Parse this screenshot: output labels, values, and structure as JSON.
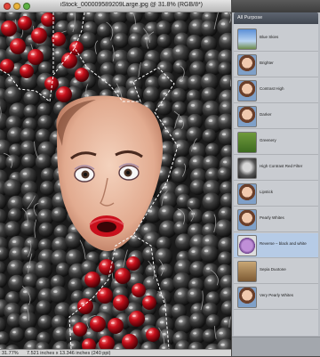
{
  "window": {
    "title": "iStock_000009589209Large.jpg @ 31.8% (RGB/8*)"
  },
  "status": {
    "zoom": "31.77%",
    "doc_size": "7.521 inches x 13.346 inches (240 ppi)"
  },
  "panel": {
    "tab_label": "All Purpose",
    "items": [
      {
        "label": "Blue Skies",
        "icon": "sky-thumbnail",
        "selected": false
      },
      {
        "label": "Brighter",
        "icon": "portrait-thumbnail",
        "selected": false
      },
      {
        "label": "Contrast High",
        "icon": "portrait-thumbnail",
        "selected": false
      },
      {
        "label": "Darker",
        "icon": "portrait-thumbnail",
        "selected": false
      },
      {
        "label": "Greenery",
        "icon": "greenery-thumbnail",
        "selected": false
      },
      {
        "label": "High Contrast Red Filter",
        "icon": "red-filter-thumbnail",
        "selected": false
      },
      {
        "label": "Lipstick",
        "icon": "portrait-thumbnail",
        "selected": false
      },
      {
        "label": "Pearly Whites",
        "icon": "portrait-thumbnail",
        "selected": false
      },
      {
        "label": "Reverse – black and white",
        "icon": "rose-thumbnail",
        "selected": true
      },
      {
        "label": "Sepia Duotone",
        "icon": "sepia-thumbnail",
        "selected": false
      },
      {
        "label": "Very Pearly Whites",
        "icon": "portrait-thumbnail",
        "selected": false
      }
    ]
  },
  "colors": {
    "selection_highlight": "#b6cbe6",
    "cherry_red": "#c8101c",
    "panel_tab": "#4d535c"
  }
}
